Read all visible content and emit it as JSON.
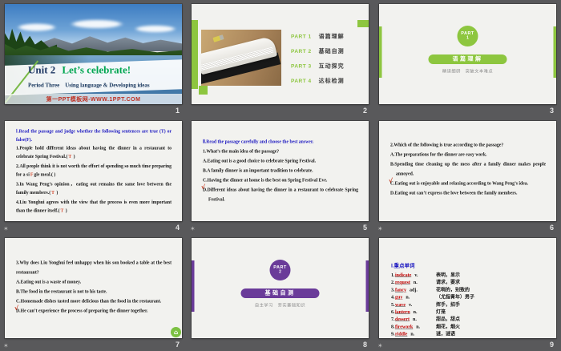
{
  "page_numbers": [
    "1",
    "2",
    "3",
    "4",
    "5",
    "6",
    "7",
    "8",
    "9"
  ],
  "star": "✶",
  "colors": {
    "canvas_bg": "#59595b",
    "slide_bg": "#f2f2ef",
    "green_accent": "#8dc63f",
    "purple_accent": "#6a3b99",
    "heading_blue": "#1a16c0",
    "answer_red": "#d5472c",
    "word_red": "#c00000",
    "navy": "#1f3864",
    "title_green": "#00a651"
  },
  "slide1": {
    "unit": "Unit 2",
    "title": "Let’s celebrate!",
    "period": "Period Three    Using language & Developing ideas",
    "watermark": "第一PPT模板网-WWW.1PPT.COM"
  },
  "slide2": {
    "parts": [
      {
        "label": "PART 1",
        "title": "语篇理解"
      },
      {
        "label": "PART 2",
        "title": "基础自测"
      },
      {
        "label": "PART 3",
        "title": "互动探究"
      },
      {
        "label": "PART 4",
        "title": "达标检测"
      }
    ]
  },
  "slide3": {
    "part": "PART",
    "num": "1",
    "title": "语篇理解",
    "subtitle": "精读细研　突破文本难点"
  },
  "slide4": {
    "heading": "Ⅰ.Read the passage and judge whether the following sentences are true (T) or false(F).",
    "items": [
      {
        "segs": [
          {
            "t": "1.People hold different ideas about having the dinner in a restaurant to celebrate Spring Festival.("
          },
          {
            "t": "T"
          },
          {
            "t": " )"
          }
        ]
      },
      {
        "segs": [
          {
            "t": "2.All people think it is not worth the effort of spending so much time preparing for a si"
          },
          {
            "t": "F"
          },
          {
            "t": "gle meal.(   )"
          }
        ]
      },
      {
        "segs": [
          {
            "t": "3.In Wang Peng’s opinion，eating out remains the same love between the family members.("
          },
          {
            "t": "T"
          },
          {
            "t": " )"
          }
        ]
      },
      {
        "segs": [
          {
            "t": "4.Liu Yonghui agrees with the view that the process is even more important than the dinner itself.("
          },
          {
            "t": "T"
          },
          {
            "t": " )"
          }
        ]
      }
    ]
  },
  "slide5": {
    "heading": "Ⅱ.Read the passage carefully and choose the best answer.",
    "question": "1.What’s the main idea of the passage?",
    "options": [
      {
        "check": "",
        "text": "A.Eating out is a good choice to celebrate Spring Festival."
      },
      {
        "check": "",
        "text": "B.A family dinner is an important tradition to celebrate."
      },
      {
        "check": "",
        "text": "C.Having the dinner at home is the best on Spring Festival Eve."
      },
      {
        "check": "√",
        "text": "D.Different ideas about having the dinner in a restaurant to celebrate Spring Festival."
      }
    ]
  },
  "slide6": {
    "question": "2.Which of the following is true according to the passage?",
    "options": [
      {
        "check": "",
        "text": "A.The preparations for the dinner are easy work."
      },
      {
        "check": "",
        "text": "B.Spending time cleaning up the mess after a family dinner makes people annoyed."
      },
      {
        "check": "√",
        "text": "C.Eating out is enjoyable and relaxing according to Wang Peng’s idea."
      },
      {
        "check": "",
        "text": "D.Eating out can’t express the love between the family members."
      }
    ]
  },
  "slide7": {
    "question": "3.Why does Liu Yonghui feel unhappy when his son booked a table at the best restaurant?",
    "options": [
      {
        "check": "",
        "text": "A.Eating out is a waste of money."
      },
      {
        "check": "",
        "text": "B.The food in the restaurant is not to his taste."
      },
      {
        "check": "",
        "text": "C.Homemade dishes tasted more delicious than the food in the restaurant."
      },
      {
        "check": "√",
        "text": "D.He can’t experience the process of preparing the dinner together."
      }
    ],
    "home_icon": "⌂"
  },
  "slide8": {
    "part": "PART",
    "num": "2",
    "title": "基础自测",
    "subtitle": "自主学习　夯实基础知识"
  },
  "slide9": {
    "heading": "Ⅰ.重点单词",
    "words": [
      {
        "no": "1.",
        "word": "indicate",
        "pos": "v.",
        "cn": "表明，显示"
      },
      {
        "no": "2.",
        "word": "request",
        "pos": "n.",
        "cn": "请求，要求"
      },
      {
        "no": "3.",
        "word": "fancy",
        "pos": "adj.",
        "cn": "花哨的，别致的"
      },
      {
        "no": "4.",
        "word": "guy",
        "pos": "n.",
        "cn": "（尤指青年）男子"
      },
      {
        "no": "5.",
        "word": "wave",
        "pos": "v.",
        "cn": "挥手，招手"
      },
      {
        "no": "6.",
        "word": "lantern",
        "pos": "n.",
        "cn": "灯笼"
      },
      {
        "no": "7.",
        "word": "dessert",
        "pos": "n.",
        "cn": "甜品，甜点"
      },
      {
        "no": "8.",
        "word": "firework",
        "pos": "n.",
        "cn": "烟花，烟火"
      },
      {
        "no": "9.",
        "word": "riddle",
        "pos": "n.",
        "cn": "谜，谜语"
      }
    ]
  }
}
